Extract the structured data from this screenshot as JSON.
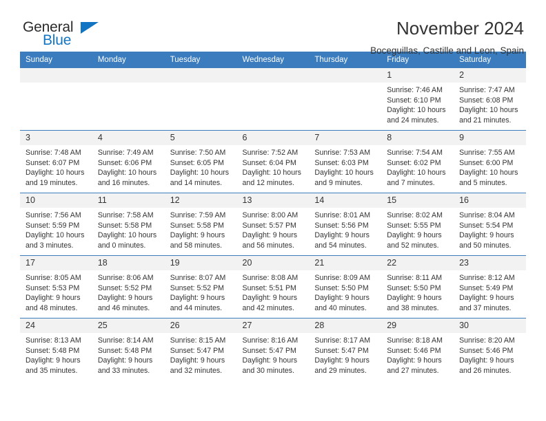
{
  "logo": {
    "word1": "General",
    "word2": "Blue",
    "triangle_color": "#1275c4"
  },
  "header": {
    "title": "November 2024",
    "subtitle": "Boceguillas, Castille and Leon, Spain"
  },
  "theme": {
    "header_bg": "#3a7cbe",
    "daynum_bg": "#f2f2f2",
    "text": "#333333"
  },
  "calendar": {
    "weekday_headers": [
      "Sunday",
      "Monday",
      "Tuesday",
      "Wednesday",
      "Thursday",
      "Friday",
      "Saturday"
    ],
    "weeks": [
      [
        {
          "day": "",
          "sunrise": "",
          "sunset": "",
          "daylight": "",
          "empty": true
        },
        {
          "day": "",
          "sunrise": "",
          "sunset": "",
          "daylight": "",
          "empty": true
        },
        {
          "day": "",
          "sunrise": "",
          "sunset": "",
          "daylight": "",
          "empty": true
        },
        {
          "day": "",
          "sunrise": "",
          "sunset": "",
          "daylight": "",
          "empty": true
        },
        {
          "day": "",
          "sunrise": "",
          "sunset": "",
          "daylight": "",
          "empty": true
        },
        {
          "day": "1",
          "sunrise": "Sunrise: 7:46 AM",
          "sunset": "Sunset: 6:10 PM",
          "daylight": "Daylight: 10 hours and 24 minutes."
        },
        {
          "day": "2",
          "sunrise": "Sunrise: 7:47 AM",
          "sunset": "Sunset: 6:08 PM",
          "daylight": "Daylight: 10 hours and 21 minutes."
        }
      ],
      [
        {
          "day": "3",
          "sunrise": "Sunrise: 7:48 AM",
          "sunset": "Sunset: 6:07 PM",
          "daylight": "Daylight: 10 hours and 19 minutes."
        },
        {
          "day": "4",
          "sunrise": "Sunrise: 7:49 AM",
          "sunset": "Sunset: 6:06 PM",
          "daylight": "Daylight: 10 hours and 16 minutes."
        },
        {
          "day": "5",
          "sunrise": "Sunrise: 7:50 AM",
          "sunset": "Sunset: 6:05 PM",
          "daylight": "Daylight: 10 hours and 14 minutes."
        },
        {
          "day": "6",
          "sunrise": "Sunrise: 7:52 AM",
          "sunset": "Sunset: 6:04 PM",
          "daylight": "Daylight: 10 hours and 12 minutes."
        },
        {
          "day": "7",
          "sunrise": "Sunrise: 7:53 AM",
          "sunset": "Sunset: 6:03 PM",
          "daylight": "Daylight: 10 hours and 9 minutes."
        },
        {
          "day": "8",
          "sunrise": "Sunrise: 7:54 AM",
          "sunset": "Sunset: 6:02 PM",
          "daylight": "Daylight: 10 hours and 7 minutes."
        },
        {
          "day": "9",
          "sunrise": "Sunrise: 7:55 AM",
          "sunset": "Sunset: 6:00 PM",
          "daylight": "Daylight: 10 hours and 5 minutes."
        }
      ],
      [
        {
          "day": "10",
          "sunrise": "Sunrise: 7:56 AM",
          "sunset": "Sunset: 5:59 PM",
          "daylight": "Daylight: 10 hours and 3 minutes."
        },
        {
          "day": "11",
          "sunrise": "Sunrise: 7:58 AM",
          "sunset": "Sunset: 5:58 PM",
          "daylight": "Daylight: 10 hours and 0 minutes."
        },
        {
          "day": "12",
          "sunrise": "Sunrise: 7:59 AM",
          "sunset": "Sunset: 5:58 PM",
          "daylight": "Daylight: 9 hours and 58 minutes."
        },
        {
          "day": "13",
          "sunrise": "Sunrise: 8:00 AM",
          "sunset": "Sunset: 5:57 PM",
          "daylight": "Daylight: 9 hours and 56 minutes."
        },
        {
          "day": "14",
          "sunrise": "Sunrise: 8:01 AM",
          "sunset": "Sunset: 5:56 PM",
          "daylight": "Daylight: 9 hours and 54 minutes."
        },
        {
          "day": "15",
          "sunrise": "Sunrise: 8:02 AM",
          "sunset": "Sunset: 5:55 PM",
          "daylight": "Daylight: 9 hours and 52 minutes."
        },
        {
          "day": "16",
          "sunrise": "Sunrise: 8:04 AM",
          "sunset": "Sunset: 5:54 PM",
          "daylight": "Daylight: 9 hours and 50 minutes."
        }
      ],
      [
        {
          "day": "17",
          "sunrise": "Sunrise: 8:05 AM",
          "sunset": "Sunset: 5:53 PM",
          "daylight": "Daylight: 9 hours and 48 minutes."
        },
        {
          "day": "18",
          "sunrise": "Sunrise: 8:06 AM",
          "sunset": "Sunset: 5:52 PM",
          "daylight": "Daylight: 9 hours and 46 minutes."
        },
        {
          "day": "19",
          "sunrise": "Sunrise: 8:07 AM",
          "sunset": "Sunset: 5:52 PM",
          "daylight": "Daylight: 9 hours and 44 minutes."
        },
        {
          "day": "20",
          "sunrise": "Sunrise: 8:08 AM",
          "sunset": "Sunset: 5:51 PM",
          "daylight": "Daylight: 9 hours and 42 minutes."
        },
        {
          "day": "21",
          "sunrise": "Sunrise: 8:09 AM",
          "sunset": "Sunset: 5:50 PM",
          "daylight": "Daylight: 9 hours and 40 minutes."
        },
        {
          "day": "22",
          "sunrise": "Sunrise: 8:11 AM",
          "sunset": "Sunset: 5:50 PM",
          "daylight": "Daylight: 9 hours and 38 minutes."
        },
        {
          "day": "23",
          "sunrise": "Sunrise: 8:12 AM",
          "sunset": "Sunset: 5:49 PM",
          "daylight": "Daylight: 9 hours and 37 minutes."
        }
      ],
      [
        {
          "day": "24",
          "sunrise": "Sunrise: 8:13 AM",
          "sunset": "Sunset: 5:48 PM",
          "daylight": "Daylight: 9 hours and 35 minutes."
        },
        {
          "day": "25",
          "sunrise": "Sunrise: 8:14 AM",
          "sunset": "Sunset: 5:48 PM",
          "daylight": "Daylight: 9 hours and 33 minutes."
        },
        {
          "day": "26",
          "sunrise": "Sunrise: 8:15 AM",
          "sunset": "Sunset: 5:47 PM",
          "daylight": "Daylight: 9 hours and 32 minutes."
        },
        {
          "day": "27",
          "sunrise": "Sunrise: 8:16 AM",
          "sunset": "Sunset: 5:47 PM",
          "daylight": "Daylight: 9 hours and 30 minutes."
        },
        {
          "day": "28",
          "sunrise": "Sunrise: 8:17 AM",
          "sunset": "Sunset: 5:47 PM",
          "daylight": "Daylight: 9 hours and 29 minutes."
        },
        {
          "day": "29",
          "sunrise": "Sunrise: 8:18 AM",
          "sunset": "Sunset: 5:46 PM",
          "daylight": "Daylight: 9 hours and 27 minutes."
        },
        {
          "day": "30",
          "sunrise": "Sunrise: 8:20 AM",
          "sunset": "Sunset: 5:46 PM",
          "daylight": "Daylight: 9 hours and 26 minutes."
        }
      ]
    ]
  }
}
